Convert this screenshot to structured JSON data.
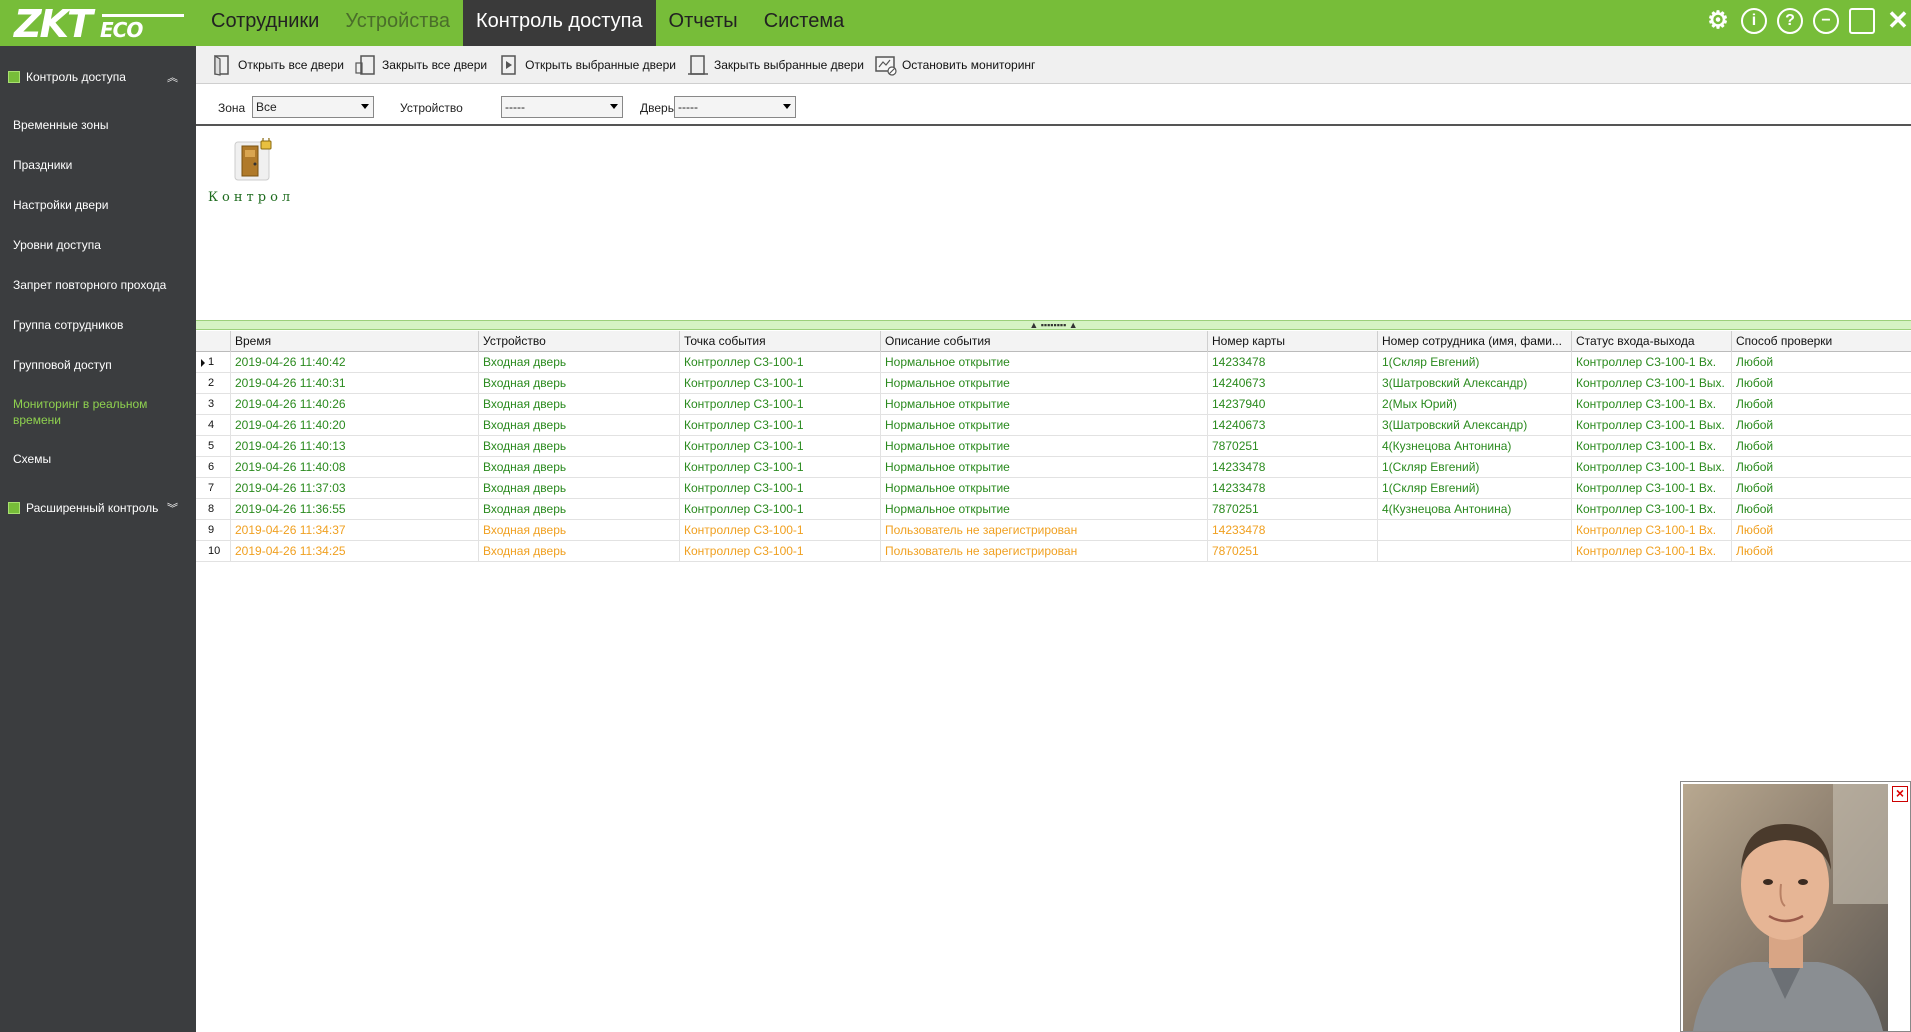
{
  "app": {
    "logo_main": "ZKT",
    "logo_sub": "ECO"
  },
  "nav": {
    "items": [
      {
        "label": "Сотрудники"
      },
      {
        "label": "Устройства"
      },
      {
        "label": "Контроль доступа"
      },
      {
        "label": "Отчеты"
      },
      {
        "label": "Система"
      }
    ],
    "active": "Контроль доступа"
  },
  "window_icons": [
    "gear-icon",
    "info-icon",
    "help-icon",
    "minimize-icon",
    "maximize-icon",
    "close-icon"
  ],
  "sidebar": {
    "section_top": "Контроль доступа",
    "items": [
      {
        "label": "Временные зоны"
      },
      {
        "label": "Праздники"
      },
      {
        "label": "Настройки двери"
      },
      {
        "label": "Уровни доступа"
      },
      {
        "label": "Запрет повторного прохода"
      },
      {
        "label": "Группа сотрудников"
      },
      {
        "label": "Групповой доступ"
      },
      {
        "label": "Мониторинг в реальном времени"
      },
      {
        "label": "Схемы"
      }
    ],
    "active": "Мониторинг в реальном времени",
    "section_bottom": "Расширенный контроль"
  },
  "toolbar": {
    "open_all": "Открыть все двери",
    "close_all": "Закрыть все двери",
    "open_selected": "Открыть выбранные двери",
    "close_selected": "Закрыть выбранные двери",
    "stop_monitoring": "Остановить мониторинг"
  },
  "filters": {
    "zone_label": "Зона",
    "zone_value": "Все",
    "device_label": "Устройство",
    "device_value": "-----",
    "door_label": "Дверь",
    "door_value": "-----"
  },
  "door": {
    "label": "Контрол"
  },
  "table": {
    "headers": [
      "Время",
      "Устройство",
      "Точка события",
      "Описание события",
      "Номер карты",
      "Номер сотрудника (имя, фами...",
      "Статус входа-выхода",
      "Способ проверки"
    ],
    "rows": [
      {
        "n": "1",
        "time": "2019-04-26 11:40:42",
        "device": "Входная дверь",
        "point": "Контроллер C3-100-1",
        "desc": "Нормальное открытие",
        "card": "14233478",
        "emp": "1(Скляр Евгений)",
        "status": "Контроллер C3-100-1 Вх.",
        "method": "Любой",
        "color": "green"
      },
      {
        "n": "2",
        "time": "2019-04-26 11:40:31",
        "device": "Входная дверь",
        "point": "Контроллер C3-100-1",
        "desc": "Нормальное открытие",
        "card": "14240673",
        "emp": "3(Шатровский Александр)",
        "status": "Контроллер C3-100-1 Вых.",
        "method": "Любой",
        "color": "green"
      },
      {
        "n": "3",
        "time": "2019-04-26 11:40:26",
        "device": "Входная дверь",
        "point": "Контроллер C3-100-1",
        "desc": "Нормальное открытие",
        "card": "14237940",
        "emp": "2(Мых Юрий)",
        "status": "Контроллер C3-100-1 Вх.",
        "method": "Любой",
        "color": "green"
      },
      {
        "n": "4",
        "time": "2019-04-26 11:40:20",
        "device": "Входная дверь",
        "point": "Контроллер C3-100-1",
        "desc": "Нормальное открытие",
        "card": "14240673",
        "emp": "3(Шатровский Александр)",
        "status": "Контроллер C3-100-1 Вых.",
        "method": "Любой",
        "color": "green"
      },
      {
        "n": "5",
        "time": "2019-04-26 11:40:13",
        "device": "Входная дверь",
        "point": "Контроллер C3-100-1",
        "desc": "Нормальное открытие",
        "card": "7870251",
        "emp": "4(Кузнецова Антонина)",
        "status": "Контроллер C3-100-1 Вх.",
        "method": "Любой",
        "color": "green"
      },
      {
        "n": "6",
        "time": "2019-04-26 11:40:08",
        "device": "Входная дверь",
        "point": "Контроллер C3-100-1",
        "desc": "Нормальное открытие",
        "card": "14233478",
        "emp": "1(Скляр Евгений)",
        "status": "Контроллер C3-100-1 Вых.",
        "method": "Любой",
        "color": "green"
      },
      {
        "n": "7",
        "time": "2019-04-26 11:37:03",
        "device": "Входная дверь",
        "point": "Контроллер C3-100-1",
        "desc": "Нормальное открытие",
        "card": "14233478",
        "emp": "1(Скляр Евгений)",
        "status": "Контроллер C3-100-1 Вх.",
        "method": "Любой",
        "color": "green"
      },
      {
        "n": "8",
        "time": "2019-04-26 11:36:55",
        "device": "Входная дверь",
        "point": "Контроллер C3-100-1",
        "desc": "Нормальное открытие",
        "card": "7870251",
        "emp": "4(Кузнецова Антонина)",
        "status": "Контроллер C3-100-1 Вх.",
        "method": "Любой",
        "color": "green"
      },
      {
        "n": "9",
        "time": "2019-04-26 11:34:37",
        "device": "Входная дверь",
        "point": "Контроллер C3-100-1",
        "desc": "Пользователь не зарегистрирован",
        "card": "14233478",
        "emp": "",
        "status": "Контроллер C3-100-1 Вх.",
        "method": "Любой",
        "color": "orange"
      },
      {
        "n": "10",
        "time": "2019-04-26 11:34:25",
        "device": "Входная дверь",
        "point": "Контроллер C3-100-1",
        "desc": "Пользователь не зарегистрирован",
        "card": "7870251",
        "emp": "",
        "status": "Контроллер C3-100-1 Вх.",
        "method": "Любой",
        "color": "orange"
      }
    ]
  },
  "colors": {
    "brand": "#77bd39",
    "sidebar_bg": "#3b3d3f",
    "row_ok": "#2a8a1e",
    "row_warn": "#f0a020"
  }
}
